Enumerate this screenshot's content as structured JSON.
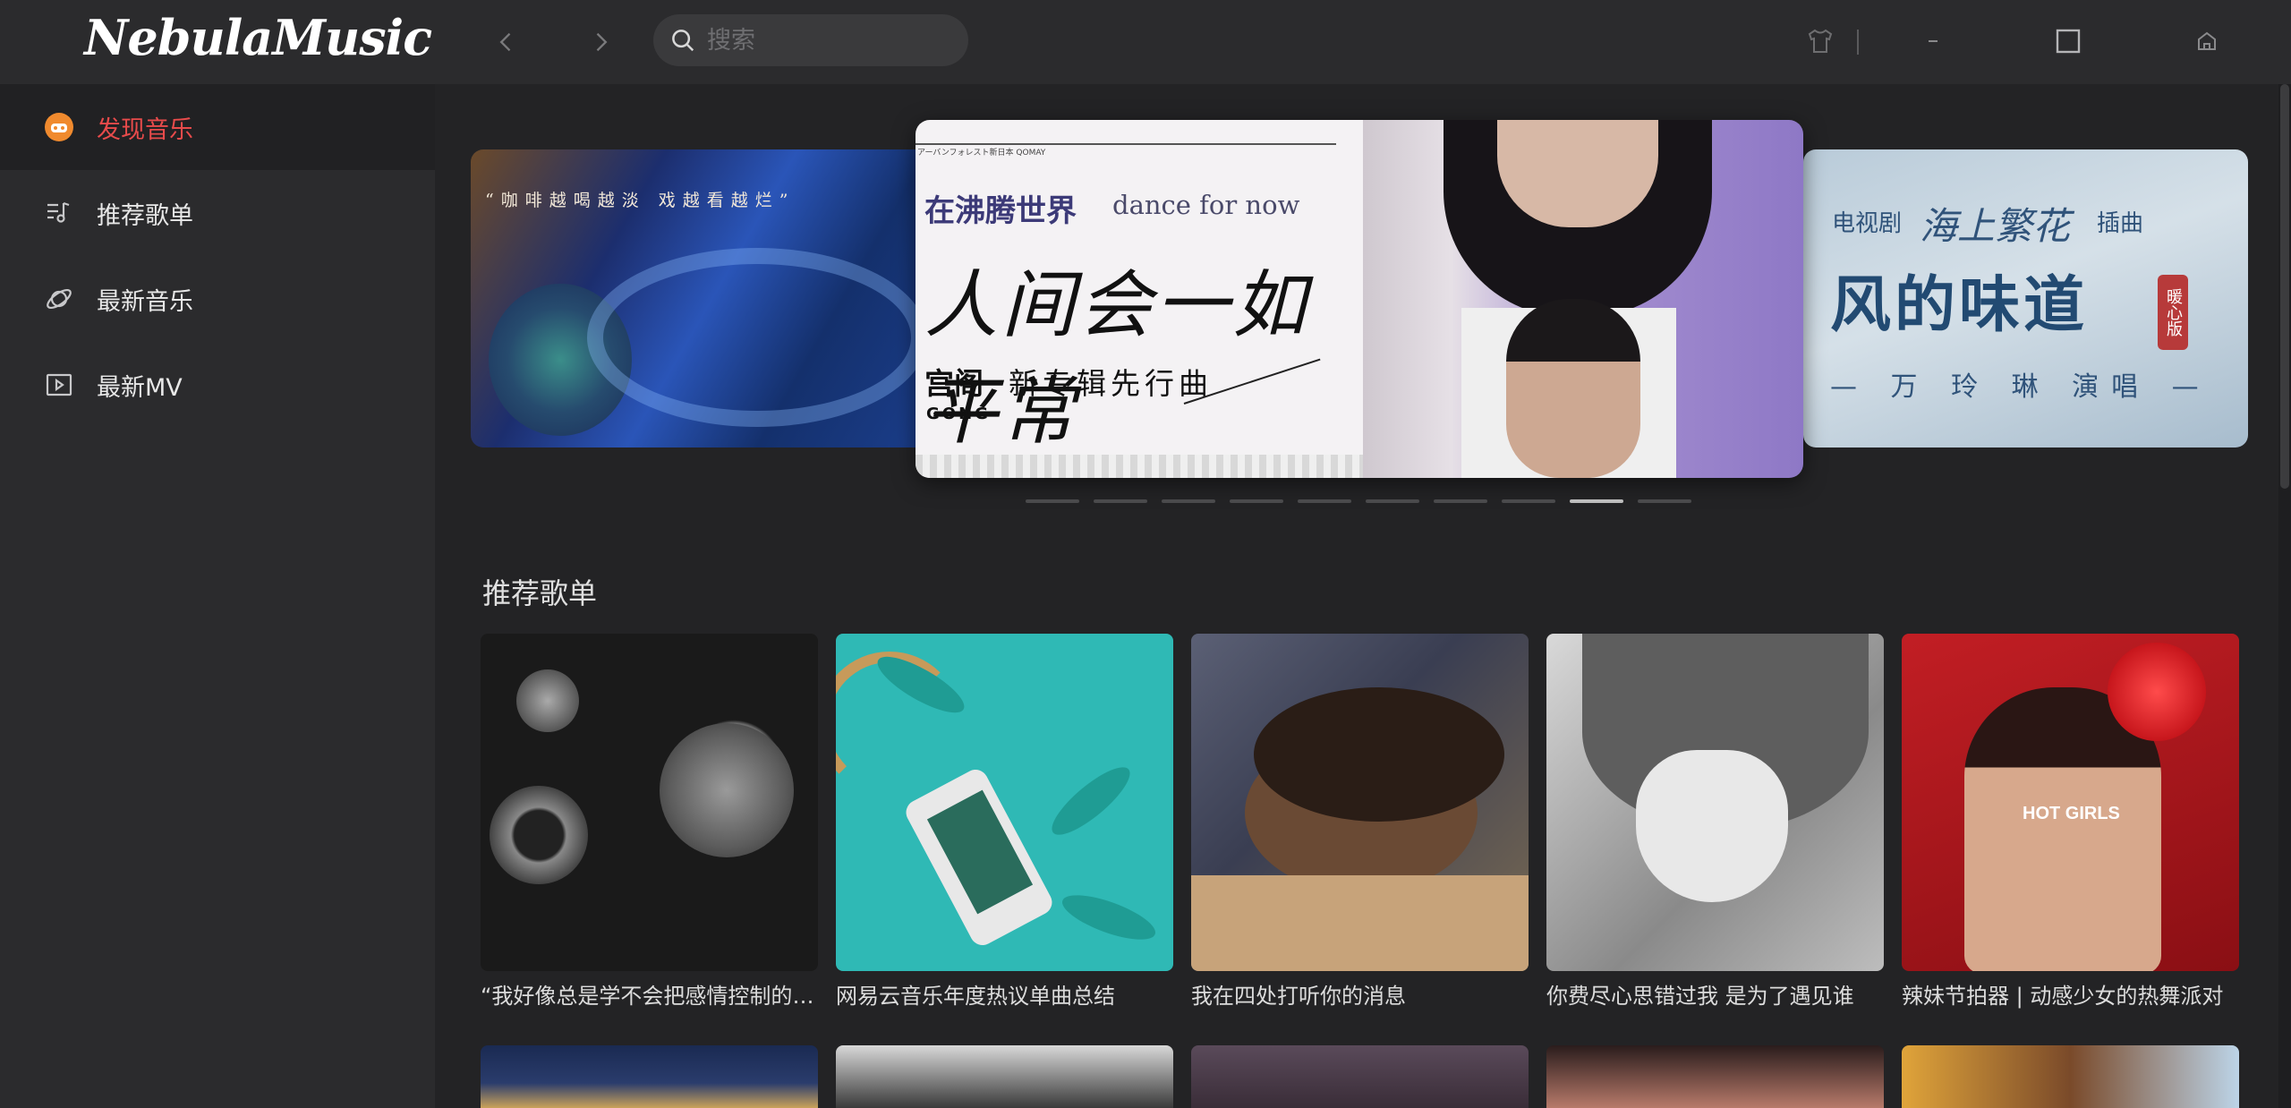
{
  "app": {
    "logo": "NebulaMusic"
  },
  "header": {
    "search_placeholder": "搜索",
    "icons": [
      "chevron-left-icon",
      "chevron-right-icon",
      "search-icon",
      "skin-icon",
      "minimize-icon",
      "maximize-icon",
      "home-icon"
    ]
  },
  "sidebar": {
    "active_color": "#e84b4b",
    "items": [
      {
        "label": "发现音乐",
        "icon": "discover-icon",
        "active": true
      },
      {
        "label": "推荐歌单",
        "icon": "playlist-icon",
        "active": false
      },
      {
        "label": "最新音乐",
        "icon": "planet-icon",
        "active": false
      },
      {
        "label": "最新MV",
        "icon": "video-icon",
        "active": false
      }
    ]
  },
  "banner": {
    "left": {
      "quote": "“咖啡越喝越淡  戏越看越烂”"
    },
    "center": {
      "small_print": "アーバンフォレスト新日本 QOMAY",
      "title_cn": "在沸腾世界",
      "title_en": "dance for now",
      "handwriting": "人间会一如平常",
      "artist": "宫阁",
      "subtitle": "新专辑先行曲",
      "brand": "GONG"
    },
    "right": {
      "prefix": "电视剧",
      "show": "海上繁花",
      "suffix": "插曲",
      "song": "风的味道",
      "stamp": "暖心版",
      "singer": "— 万 玲 琳 演唱 —"
    },
    "dots_total": 10,
    "dots_active_index": 8
  },
  "recommend": {
    "title": "推荐歌单",
    "playlists": [
      {
        "name": "“我好像总是学不会把感情控制的当”"
      },
      {
        "name": "网易云音乐年度热议单曲总结"
      },
      {
        "name": "我在四处打听你的消息"
      },
      {
        "name": "你费尽心思错过我 是为了遇见谁"
      },
      {
        "name": "辣妹节拍器 | 动感少女的热舞派对",
        "cover_text": "HOT GIRLS"
      }
    ]
  }
}
